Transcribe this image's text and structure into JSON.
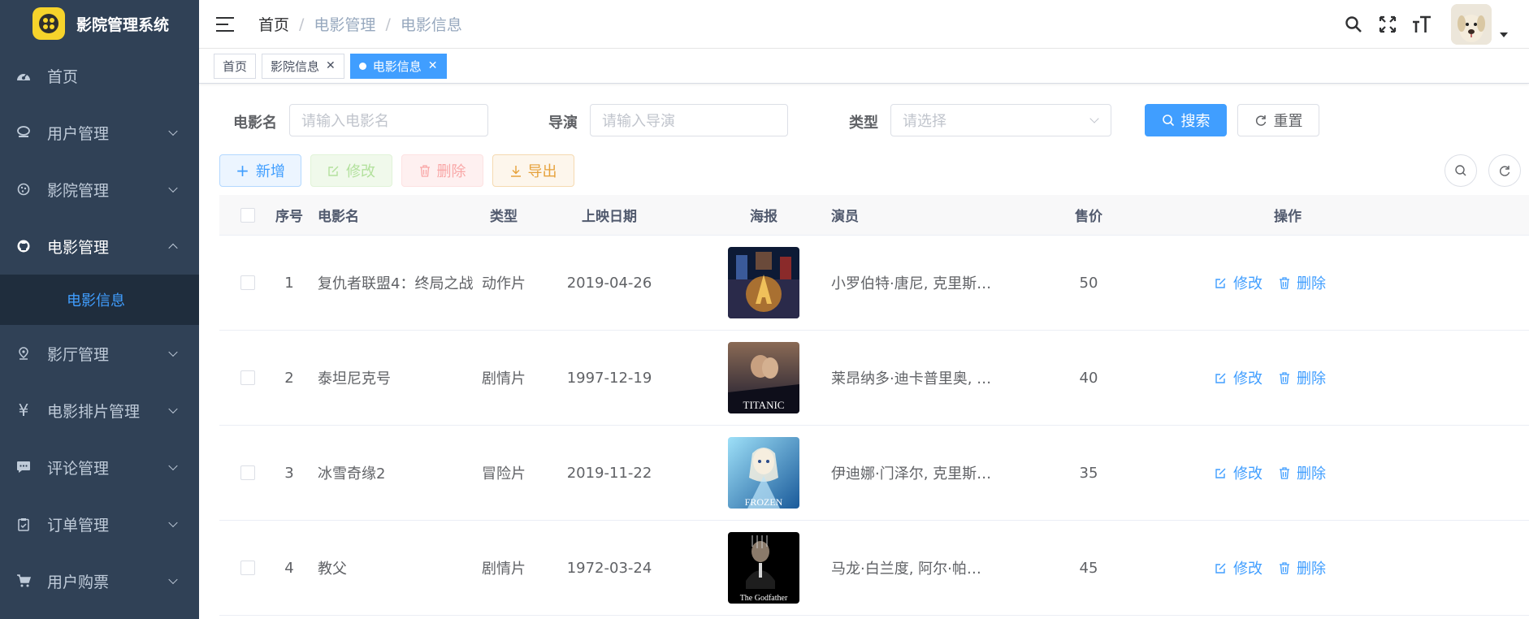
{
  "app": {
    "title": "影院管理系统"
  },
  "sidebar": {
    "items": [
      {
        "label": "首页",
        "icon": "dashboard-icon",
        "expandable": false
      },
      {
        "label": "用户管理",
        "icon": "user-icon",
        "expandable": true
      },
      {
        "label": "影院管理",
        "icon": "cinema-icon",
        "expandable": true
      },
      {
        "label": "电影管理",
        "icon": "github-icon",
        "expandable": true,
        "open": true
      },
      {
        "label": "影厅管理",
        "icon": "location-icon",
        "expandable": true
      },
      {
        "label": "电影排片管理",
        "icon": "yuan-icon",
        "expandable": true
      },
      {
        "label": "评论管理",
        "icon": "message-icon",
        "expandable": true
      },
      {
        "label": "订单管理",
        "icon": "clipboard-icon",
        "expandable": true
      },
      {
        "label": "用户购票",
        "icon": "cart-icon",
        "expandable": true
      }
    ],
    "submenu": {
      "label": "电影信息"
    }
  },
  "navbar": {
    "breadcrumb": [
      "首页",
      "电影管理",
      "电影信息"
    ]
  },
  "tags": [
    {
      "label": "首页",
      "closable": false,
      "active": false
    },
    {
      "label": "影院信息",
      "closable": true,
      "active": false
    },
    {
      "label": "电影信息",
      "closable": true,
      "active": true
    }
  ],
  "search": {
    "name_label": "电影名",
    "name_placeholder": "请输入电影名",
    "director_label": "导演",
    "director_placeholder": "请输入导演",
    "type_label": "类型",
    "type_placeholder": "请选择",
    "search_label": "搜索",
    "reset_label": "重置"
  },
  "toolbar": {
    "add": "新增",
    "edit": "修改",
    "delete": "删除",
    "export": "导出"
  },
  "table": {
    "headers": {
      "index": "序号",
      "name": "电影名",
      "type": "类型",
      "date": "上映日期",
      "poster": "海报",
      "actors": "演员",
      "price": "售价",
      "ops": "操作"
    },
    "rows": [
      {
        "index": "1",
        "name": "复仇者联盟4：终局之战",
        "type": "动作片",
        "date": "2019-04-26",
        "actors": "小罗伯特·唐尼, 克里斯·埃文斯",
        "price": "50",
        "poster_colors": [
          "#0d1a35",
          "#c9822a"
        ]
      },
      {
        "index": "2",
        "name": "泰坦尼克号",
        "type": "剧情片",
        "date": "1997-12-19",
        "actors": "莱昂纳多·迪卡普里奥, 凯特·温斯莱特",
        "price": "40",
        "poster_text": "TITANIC",
        "poster_colors": [
          "#6b4a3a",
          "#1a1a2e"
        ]
      },
      {
        "index": "3",
        "name": "冰雪奇缘2",
        "type": "冒险片",
        "date": "2019-11-22",
        "actors": "伊迪娜·门泽尔, 克里斯汀·贝尔",
        "price": "35",
        "poster_text": "FROZEN",
        "poster_colors": [
          "#7fd0f0",
          "#1a5a9a"
        ]
      },
      {
        "index": "4",
        "name": "教父",
        "type": "剧情片",
        "date": "1972-03-24",
        "actors": "马龙·白兰度, 阿尔·帕西诺",
        "price": "45",
        "poster_text": "The Godfather",
        "poster_colors": [
          "#000000",
          "#333333"
        ]
      }
    ],
    "op_edit": "修改",
    "op_delete": "删除"
  },
  "colors": {
    "sidebar": "#304156",
    "accent": "#409eff"
  }
}
